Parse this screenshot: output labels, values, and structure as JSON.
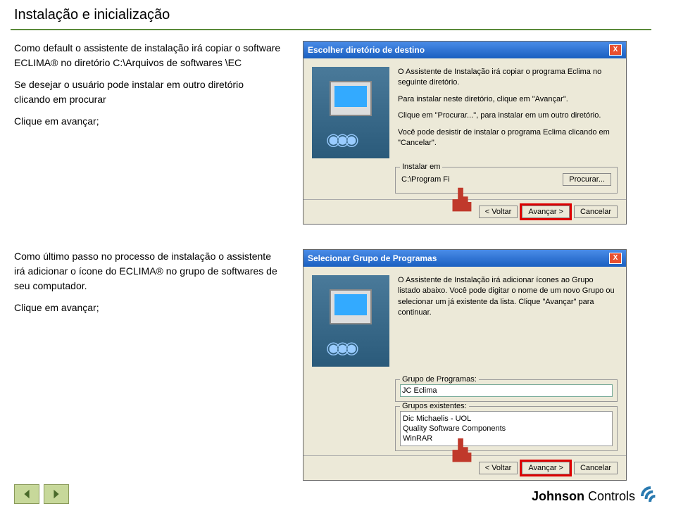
{
  "page": {
    "title": "Instalação e inicialização"
  },
  "section1": {
    "text1": "Como default o assistente de instalação irá copiar o software ECLIMA® no diretório C:\\Arquivos de softwares \\EC",
    "text2": "Se desejar o  usuário pode instalar em outro diretório clicando em procurar",
    "text3": "Clique em avançar;"
  },
  "dialog1": {
    "title": "Escolher diretório de destino",
    "close": "X",
    "para1": "O Assistente de Instalação irá copiar o programa Eclima no seguinte diretório.",
    "para2": "Para instalar neste diretório, clique em \"Avançar\".",
    "para3": "Clique em \"Procurar...\", para instalar em um outro diretório.",
    "para4": "Você pode desistir de instalar o programa Eclima clicando em \"Cancelar\".",
    "boxLabel": "Instalar em",
    "path": "C:\\Program Fi",
    "procurar": "Procurar...",
    "back": "< Voltar",
    "next": "Avançar >",
    "cancel": "Cancelar"
  },
  "section2": {
    "text1": "Como último passo no processo de instalação o assistente irá adicionar o ícone do ECLIMA®  no grupo de softwares de seu computador.",
    "text2": "Clique em avançar;"
  },
  "dialog2": {
    "title": "Selecionar Grupo de Programas",
    "close": "X",
    "para1": "O Assistente de Instalação irá adicionar ícones ao Grupo listado abaixo. Você pode digitar o nome de um novo Grupo ou selecionar um já existente da lista. Clique \"Avançar\" para continuar.",
    "grpLabel": "Grupo de Programas:",
    "grpValue": "JC Eclima",
    "existLabel": "Grupos existentes:",
    "existing": [
      "Dic Michaelis - UOL",
      "Quality Software Components",
      "WinRAR"
    ],
    "back": "< Voltar",
    "next": "Avançar >",
    "cancel": "Cancelar"
  },
  "logo": {
    "t1": "Johnson",
    "t2": "Controls"
  }
}
